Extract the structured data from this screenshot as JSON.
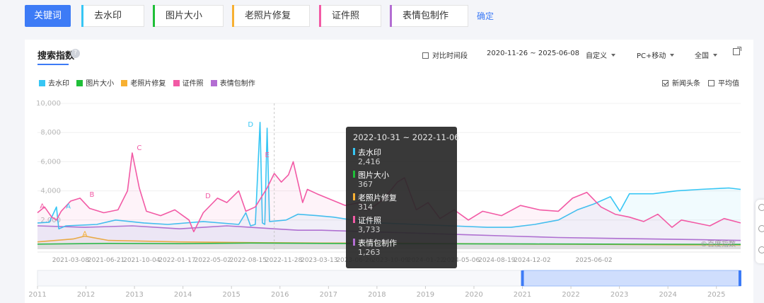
{
  "topbar": {
    "main_button": "关键词",
    "keywords": [
      {
        "label": "去水印",
        "color": "#37c6f4"
      },
      {
        "label": "图片大小",
        "color": "#1fbf38"
      },
      {
        "label": "老照片修复",
        "color": "#f7b032"
      },
      {
        "label": "证件照",
        "color": "#f25aa5"
      },
      {
        "label": "表情包制作",
        "color": "#b36dd2"
      }
    ],
    "confirm": "确定"
  },
  "card": {
    "title": "搜索指数",
    "help_icon": "?",
    "compare_label": "对比时间段",
    "date_range": "2020-11-26 ~ 2025-06-08",
    "custom_label": "自定义",
    "device_label": "PC+移动",
    "region_label": "全国",
    "news_label": "新闻头条",
    "avg_label": "平均值"
  },
  "chart_data": {
    "type": "line",
    "y_ticks": [
      "10,000",
      "8,000",
      "6,000",
      "4,000",
      "2,000"
    ],
    "ylim": [
      0,
      10000
    ],
    "x_ticks": [
      "2021-03-08",
      "2021-06-21",
      "2021-10-04",
      "2022-01-17",
      "2022-05-02",
      "2022-08-15",
      "2022-11-28",
      "2023-03-13",
      "2023-06-26",
      "2023-10-09",
      "2024-01-22",
      "2024-05-06",
      "2024-08-19",
      "2024-12-02",
      "2025-06-02"
    ],
    "annotations": [
      {
        "label": "A",
        "color": "#f25aa5",
        "value": 2800,
        "date": "2020-12-14"
      },
      {
        "label": "A",
        "color": "#37c6f4",
        "value": 2800,
        "date": "2021-03-01"
      },
      {
        "label": "A",
        "color": "#f7b032",
        "value": 900,
        "date": "2021-04-19"
      },
      {
        "label": "B",
        "color": "#f25aa5",
        "value": 3600,
        "date": "2021-05-10"
      },
      {
        "label": "C",
        "color": "#f25aa5",
        "value": 6800,
        "date": "2021-09-27"
      },
      {
        "label": "D",
        "color": "#f25aa5",
        "value": 3500,
        "date": "2022-04-18"
      },
      {
        "label": "D",
        "color": "#37c6f4",
        "value": 8400,
        "date": "2022-08-22"
      },
      {
        "label": "E",
        "color": "#f25aa5",
        "value": 6300,
        "date": "2022-10-10"
      }
    ],
    "series": [
      {
        "name": "去水印",
        "color": "#37c6f4",
        "points": [
          [
            0,
            1800
          ],
          [
            5,
            1850
          ],
          [
            8,
            2900
          ],
          [
            9,
            1400
          ],
          [
            12,
            1600
          ],
          [
            25,
            1700
          ],
          [
            33,
            2000
          ],
          [
            45,
            1800
          ],
          [
            55,
            1700
          ],
          [
            70,
            1900
          ],
          [
            85,
            1700
          ],
          [
            88,
            2500
          ],
          [
            90,
            1600
          ],
          [
            92,
            1700
          ],
          [
            94,
            8700
          ],
          [
            95,
            1800
          ],
          [
            96,
            1700
          ],
          [
            97,
            8300
          ],
          [
            98,
            1900
          ],
          [
            105,
            2000
          ],
          [
            110,
            2400
          ],
          [
            118,
            2300
          ],
          [
            125,
            2200
          ],
          [
            133,
            2000
          ],
          [
            145,
            1800
          ],
          [
            160,
            1700
          ],
          [
            175,
            1600
          ],
          [
            190,
            1500
          ],
          [
            200,
            1500
          ],
          [
            210,
            1700
          ],
          [
            220,
            2000
          ],
          [
            228,
            2700
          ],
          [
            235,
            3100
          ],
          [
            242,
            3600
          ],
          [
            246,
            2600
          ],
          [
            250,
            3800
          ],
          [
            260,
            3800
          ],
          [
            270,
            4000
          ],
          [
            280,
            4100
          ],
          [
            292,
            4200
          ],
          [
            297,
            4100
          ]
        ]
      },
      {
        "name": "图片大小",
        "color": "#1fbf38",
        "points": [
          [
            0,
            350
          ],
          [
            30,
            400
          ],
          [
            60,
            380
          ],
          [
            90,
            420
          ],
          [
            120,
            400
          ],
          [
            150,
            380
          ],
          [
            180,
            370
          ],
          [
            210,
            360
          ],
          [
            240,
            350
          ],
          [
            270,
            340
          ],
          [
            297,
            330
          ]
        ]
      },
      {
        "name": "老照片修复",
        "color": "#f7b032",
        "points": [
          [
            0,
            500
          ],
          [
            15,
            700
          ],
          [
            20,
            900
          ],
          [
            30,
            600
          ],
          [
            60,
            500
          ],
          [
            90,
            450
          ],
          [
            120,
            420
          ],
          [
            150,
            420
          ],
          [
            180,
            380
          ],
          [
            210,
            350
          ],
          [
            240,
            330
          ],
          [
            270,
            300
          ],
          [
            297,
            290
          ]
        ]
      },
      {
        "name": "证件照",
        "color": "#f25aa5",
        "points": [
          [
            0,
            2500
          ],
          [
            3,
            2900
          ],
          [
            6,
            2200
          ],
          [
            8,
            2000
          ],
          [
            10,
            2600
          ],
          [
            14,
            3300
          ],
          [
            18,
            3500
          ],
          [
            22,
            2800
          ],
          [
            28,
            2500
          ],
          [
            34,
            2700
          ],
          [
            38,
            4000
          ],
          [
            40,
            6600
          ],
          [
            43,
            4200
          ],
          [
            46,
            2600
          ],
          [
            52,
            2300
          ],
          [
            58,
            2700
          ],
          [
            64,
            2000
          ],
          [
            66,
            1200
          ],
          [
            70,
            2500
          ],
          [
            76,
            3500
          ],
          [
            80,
            3200
          ],
          [
            85,
            4000
          ],
          [
            88,
            2600
          ],
          [
            92,
            2900
          ],
          [
            97,
            4200
          ],
          [
            100,
            5200
          ],
          [
            103,
            4600
          ],
          [
            106,
            5100
          ],
          [
            108,
            6000
          ],
          [
            112,
            3200
          ],
          [
            114,
            4100
          ],
          [
            118,
            3800
          ],
          [
            124,
            3400
          ],
          [
            130,
            3000
          ],
          [
            136,
            3200
          ],
          [
            140,
            2700
          ],
          [
            146,
            3400
          ],
          [
            152,
            4600
          ],
          [
            155,
            4900
          ],
          [
            160,
            2700
          ],
          [
            165,
            3200
          ],
          [
            170,
            2100
          ],
          [
            176,
            2700
          ],
          [
            182,
            2000
          ],
          [
            188,
            2600
          ],
          [
            196,
            2300
          ],
          [
            204,
            3000
          ],
          [
            212,
            2700
          ],
          [
            220,
            2600
          ],
          [
            226,
            3500
          ],
          [
            232,
            3900
          ],
          [
            238,
            2900
          ],
          [
            244,
            2400
          ],
          [
            250,
            2200
          ],
          [
            256,
            1900
          ],
          [
            262,
            2400
          ],
          [
            268,
            1500
          ],
          [
            272,
            2000
          ],
          [
            278,
            1800
          ],
          [
            284,
            1600
          ],
          [
            290,
            2100
          ],
          [
            297,
            1800
          ]
        ]
      },
      {
        "name": "表情包制作",
        "color": "#b36dd2",
        "points": [
          [
            0,
            1600
          ],
          [
            20,
            1500
          ],
          [
            40,
            1600
          ],
          [
            60,
            1400
          ],
          [
            70,
            1500
          ],
          [
            80,
            1600
          ],
          [
            90,
            1500
          ],
          [
            100,
            1400
          ],
          [
            110,
            1300
          ],
          [
            120,
            1300
          ],
          [
            140,
            1200
          ],
          [
            160,
            1100
          ],
          [
            180,
            1000
          ],
          [
            200,
            900
          ],
          [
            220,
            800
          ],
          [
            240,
            750
          ],
          [
            260,
            700
          ],
          [
            280,
            650
          ],
          [
            297,
            600
          ]
        ]
      }
    ]
  },
  "tooltip": {
    "date": "2022-10-31 ~ 2022-11-06",
    "rows": [
      {
        "name": "去水印",
        "value": "2,416",
        "color": "#37c6f4"
      },
      {
        "name": "图片大小",
        "value": "367",
        "color": "#1fbf38"
      },
      {
        "name": "老照片修复",
        "value": "314",
        "color": "#f7b032"
      },
      {
        "name": "证件照",
        "value": "3,733",
        "color": "#f25aa5"
      },
      {
        "name": "表情包制作",
        "value": "1,263",
        "color": "#b36dd2"
      }
    ]
  },
  "navigator": {
    "years": [
      "2011",
      "2012",
      "2013",
      "2014",
      "2015",
      "2016",
      "2017",
      "2018",
      "2019",
      "2020",
      "2021",
      "2022",
      "2023",
      "2024",
      "2025"
    ],
    "selection": [
      "2021",
      "2025"
    ]
  },
  "watermark": "©百度指数"
}
